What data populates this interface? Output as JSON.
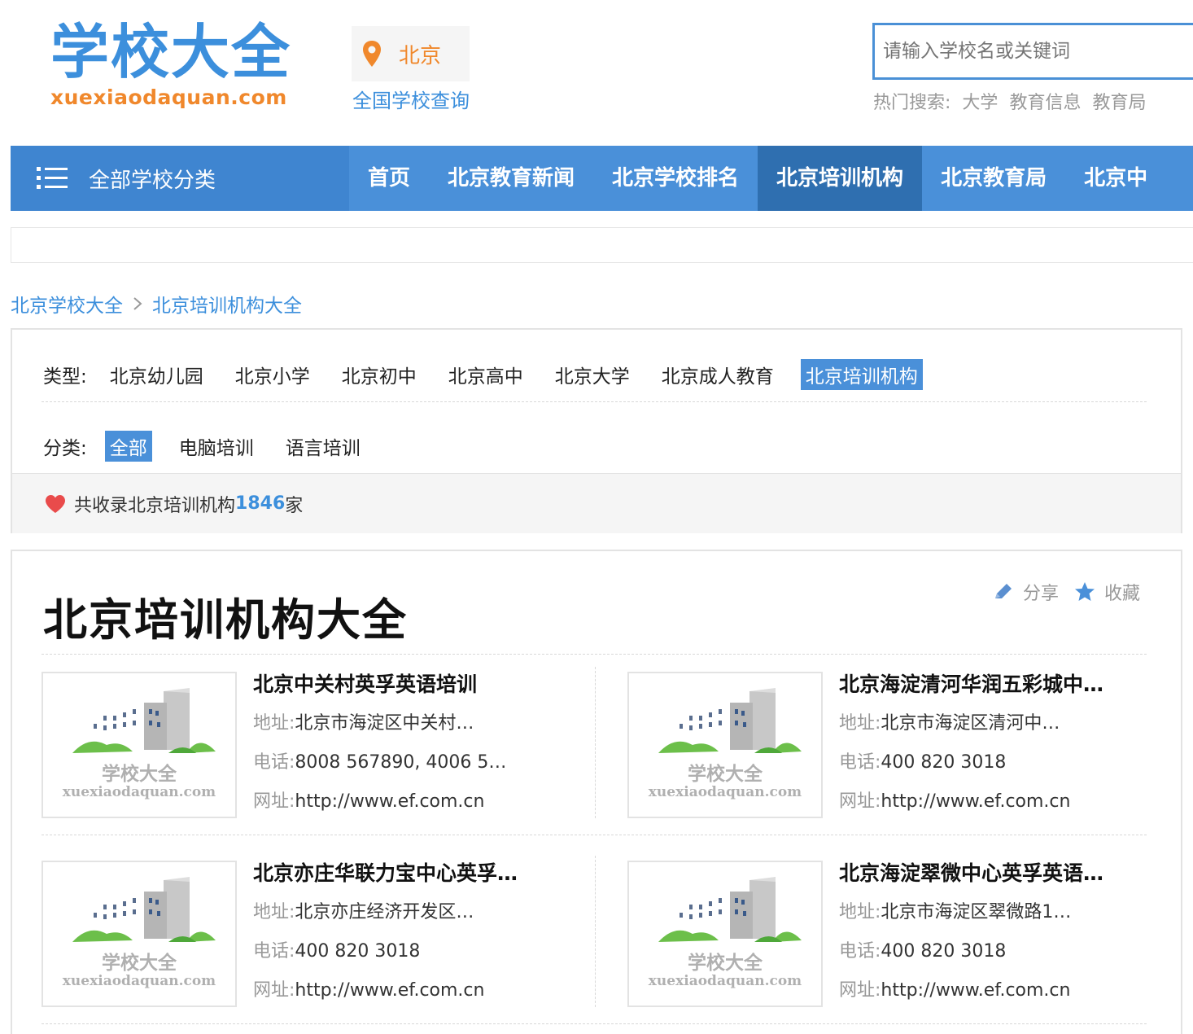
{
  "header": {
    "logo_text": "学校大全",
    "logo_sub": "xuexiaodaquan.com",
    "city": "北京",
    "city_link": "全国学校查询",
    "search_placeholder": "请输入学校名或关键词",
    "hot_label": "热门搜索:",
    "hot_links": [
      "大学",
      "教育信息",
      "教育局"
    ]
  },
  "nav": {
    "all_label": "全部学校分类",
    "items": [
      "首页",
      "北京教育新闻",
      "北京学校排名",
      "北京培训机构",
      "北京教育局",
      "北京中"
    ],
    "active_index": 3
  },
  "breadcrumb": {
    "items": [
      "北京学校大全",
      "北京培训机构大全"
    ]
  },
  "filter": {
    "type_label": "类型:",
    "types": [
      "北京幼儿园",
      "北京小学",
      "北京初中",
      "北京高中",
      "北京大学",
      "北京成人教育",
      "北京培训机构"
    ],
    "type_active": 6,
    "category_label": "分类:",
    "categories": [
      "全部",
      "电脑培训",
      "语言培训"
    ],
    "category_active": 0,
    "stat_prefix": "共收录北京培训机构",
    "stat_count": "1846",
    "stat_suffix": "家"
  },
  "main": {
    "title": "北京培训机构大全",
    "share_label": "分享",
    "fav_label": "收藏",
    "thumb_text": "学校大全",
    "thumb_sub": "xuexiaodaquan.com",
    "address_key": "地址:",
    "phone_key": "电话:",
    "url_key": "网址:",
    "schools": [
      {
        "name": "北京中关村英孚英语培训",
        "address": "北京市海淀区中关村…",
        "phone": "8008 567890, 4006 5…",
        "url": "http://www.ef.com.cn"
      },
      {
        "name": "北京海淀清河华润五彩城中…",
        "address": "北京市海淀区清河中…",
        "phone": "400 820 3018",
        "url": "http://www.ef.com.cn"
      },
      {
        "name": "北京亦庄华联力宝中心英孚…",
        "address": "北京亦庄经济开发区…",
        "phone": "400 820 3018",
        "url": "http://www.ef.com.cn"
      },
      {
        "name": "北京海淀翠微中心英孚英语…",
        "address": "北京市海淀区翠微路1…",
        "phone": "400 820 3018",
        "url": "http://www.ef.com.cn"
      }
    ]
  },
  "colors": {
    "brand_blue": "#4a90d9",
    "nav_active": "#2f6fb0",
    "accent_orange": "#f0882c",
    "link_blue": "#3c8fdc"
  }
}
